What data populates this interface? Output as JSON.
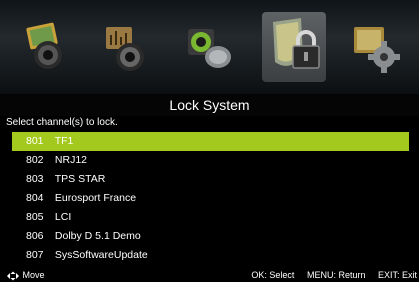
{
  "menu": {
    "icons": [
      {
        "name": "picture-settings-icon"
      },
      {
        "name": "sound-settings-icon"
      },
      {
        "name": "channel-settings-icon"
      },
      {
        "name": "lock-system-icon",
        "active": true
      },
      {
        "name": "setup-settings-icon"
      }
    ]
  },
  "page": {
    "title": "Lock System",
    "prompt": "Select channel(s) to lock."
  },
  "channels": [
    {
      "number": "801",
      "name": "TF1"
    },
    {
      "number": "802",
      "name": "NRJ12"
    },
    {
      "number": "803",
      "name": "TPS STAR"
    },
    {
      "number": "804",
      "name": "Eurosport France"
    },
    {
      "number": "805",
      "name": "LCI"
    },
    {
      "number": "806",
      "name": "Dolby D 5.1 Demo"
    },
    {
      "number": "807",
      "name": "SysSoftwareUpdate"
    }
  ],
  "selected_index": 0,
  "colors": {
    "highlight": "#a3c81e"
  },
  "footer": {
    "move": "Move",
    "ok": "OK: Select",
    "menu": "MENU: Return",
    "exit": "EXIT: Exit"
  }
}
